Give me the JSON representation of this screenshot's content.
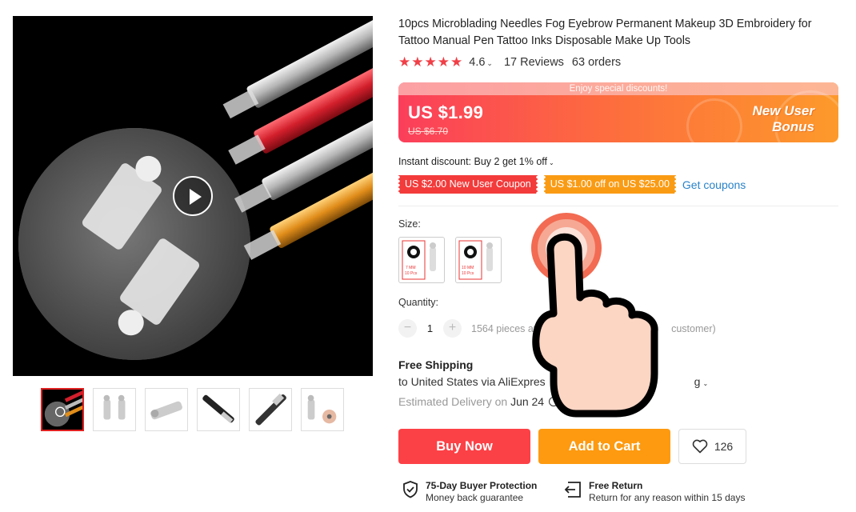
{
  "product": {
    "title": "10pcs Microblading Needles Fog Eyebrow Permanent Makeup 3D Embroidery for Tattoo Manual Pen Tattoo Inks Disposable Make Up Tools",
    "rating": "4.6",
    "reviews": "17 Reviews",
    "orders": "63 orders"
  },
  "promo": {
    "banner": "Enjoy special discounts!",
    "price": "US $1.99",
    "original_price": "US $6.70",
    "bonus_line1": "New User",
    "bonus_line2": "Bonus"
  },
  "discount": {
    "instant": "Instant discount: Buy 2 get 1% off",
    "coupon_1": "US $2.00 New User Coupon",
    "coupon_2": "US $1.00 off on US $25.00",
    "get_coupons": "Get coupons"
  },
  "size": {
    "label": "Size:",
    "options": [
      {
        "mm": "7 MM",
        "pcs": "10 Pcs"
      },
      {
        "mm": "10 MM",
        "pcs": "10 Pcs"
      }
    ]
  },
  "quantity": {
    "label": "Quantity:",
    "minus": "−",
    "value": "1",
    "plus": "+",
    "available": "1564 pieces av",
    "limit": "customer)"
  },
  "shipping": {
    "title": "Free Shipping",
    "to": "to United States via AliExpres",
    "to_tail": "g",
    "delivery_prefix": "Estimated Delivery on",
    "delivery_date": "Jun 24"
  },
  "actions": {
    "buy_now": "Buy Now",
    "add_to_cart": "Add to Cart",
    "wishlist_count": "126"
  },
  "guarantees": [
    {
      "title": "75-Day Buyer Protection",
      "subtitle": "Money back guarantee"
    },
    {
      "title": "Free Return",
      "subtitle": "Return for any reason within 15 days"
    }
  ],
  "colors": {
    "star": "#f03f47",
    "buy_now": "#fc4146",
    "add_to_cart": "#fe9a0f",
    "link": "#2a83c9",
    "tap_ring": "#f26b52",
    "finger": "#fcd5c3"
  },
  "icons": {
    "play": "play-icon",
    "heart": "heart-icon",
    "shield": "shield-check-icon",
    "return": "return-box-icon",
    "tap": "tap-hand-icon"
  }
}
